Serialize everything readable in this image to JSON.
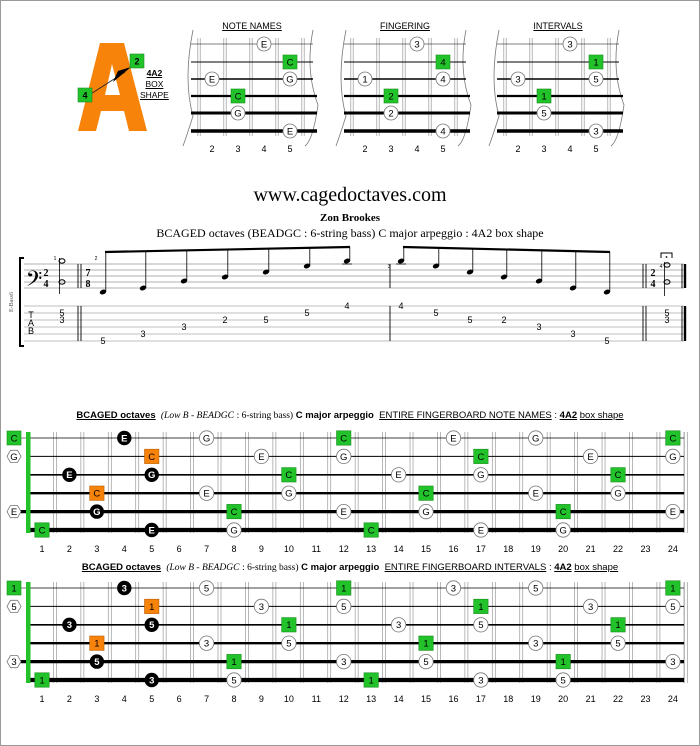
{
  "header": {
    "shape_letter": "A",
    "shape_finger_from": "4",
    "shape_finger_to": "2",
    "shape_label_lines": [
      "4A2",
      "BOX",
      "SHAPE"
    ]
  },
  "mini_diagrams": [
    {
      "title": "NOTE NAMES",
      "fret_labels": [
        "2",
        "3",
        "4",
        "5"
      ],
      "markers": [
        {
          "string": 1,
          "fret": 4,
          "label": "E",
          "kind": "circle"
        },
        {
          "string": 2,
          "fret": 5,
          "label": "C",
          "kind": "root"
        },
        {
          "string": 3,
          "fret": 2,
          "label": "E",
          "kind": "circle"
        },
        {
          "string": 3,
          "fret": 5,
          "label": "G",
          "kind": "circle"
        },
        {
          "string": 4,
          "fret": 3,
          "label": "C",
          "kind": "root"
        },
        {
          "string": 5,
          "fret": 3,
          "label": "G",
          "kind": "circle"
        },
        {
          "string": 6,
          "fret": 5,
          "label": "E",
          "kind": "circle"
        }
      ]
    },
    {
      "title": "FINGERING",
      "fret_labels": [
        "2",
        "3",
        "4",
        "5"
      ],
      "markers": [
        {
          "string": 1,
          "fret": 4,
          "label": "3",
          "kind": "circle"
        },
        {
          "string": 2,
          "fret": 5,
          "label": "4",
          "kind": "root"
        },
        {
          "string": 3,
          "fret": 2,
          "label": "1",
          "kind": "circle"
        },
        {
          "string": 3,
          "fret": 5,
          "label": "4",
          "kind": "circle"
        },
        {
          "string": 4,
          "fret": 3,
          "label": "2",
          "kind": "root"
        },
        {
          "string": 5,
          "fret": 3,
          "label": "2",
          "kind": "circle"
        },
        {
          "string": 6,
          "fret": 5,
          "label": "4",
          "kind": "circle"
        }
      ]
    },
    {
      "title": "INTERVALS",
      "fret_labels": [
        "2",
        "3",
        "4",
        "5"
      ],
      "markers": [
        {
          "string": 1,
          "fret": 4,
          "label": "3",
          "kind": "circle"
        },
        {
          "string": 2,
          "fret": 5,
          "label": "1",
          "kind": "root"
        },
        {
          "string": 3,
          "fret": 2,
          "label": "3",
          "kind": "circle"
        },
        {
          "string": 3,
          "fret": 5,
          "label": "5",
          "kind": "circle"
        },
        {
          "string": 4,
          "fret": 3,
          "label": "1",
          "kind": "root"
        },
        {
          "string": 5,
          "fret": 3,
          "label": "5",
          "kind": "circle"
        },
        {
          "string": 6,
          "fret": 5,
          "label": "3",
          "kind": "circle"
        }
      ]
    }
  ],
  "site": "www.cagedoctaves.com",
  "author": "Zon Brookes",
  "subtitle": "BCAGED octaves (BEADGC : 6-string bass) C major arpeggio : 4A2 box shape",
  "notation": {
    "instrument_label": "E-Bass6",
    "clef": "bass",
    "measures": [
      {
        "number": "1",
        "time_signature": "2/4",
        "tab": [
          {
            "string": 2,
            "fret": "5"
          },
          {
            "string": 3,
            "fret": "3"
          }
        ],
        "chord": true
      },
      {
        "number": "2",
        "time_signature": "7/8",
        "tab": [
          {
            "string": 6,
            "fret": "5"
          },
          {
            "string": 5,
            "fret": "3"
          },
          {
            "string": 4,
            "fret": "3"
          },
          {
            "string": 3,
            "fret": "2"
          },
          {
            "string": 3,
            "fret": "5"
          },
          {
            "string": 2,
            "fret": "5"
          },
          {
            "string": 1,
            "fret": "4"
          }
        ]
      },
      {
        "number": "3",
        "time_signature": "",
        "tab": [
          {
            "string": 1,
            "fret": "4"
          },
          {
            "string": 2,
            "fret": "5"
          },
          {
            "string": 3,
            "fret": "5"
          },
          {
            "string": 3,
            "fret": "2"
          },
          {
            "string": 4,
            "fret": "3"
          },
          {
            "string": 5,
            "fret": "3"
          },
          {
            "string": 6,
            "fret": "5"
          }
        ]
      },
      {
        "number": "4",
        "time_signature": "2/4",
        "tab": [
          {
            "string": 2,
            "fret": "5"
          },
          {
            "string": 3,
            "fret": "3"
          }
        ],
        "chord": true,
        "fermata": true
      }
    ],
    "tab_letters": [
      "T",
      "A",
      "B"
    ]
  },
  "fingerboards": [
    {
      "title_parts": {
        "bold_u": "BCAGED octaves",
        "italic": "(Low B - BEADGC",
        "serif": ": 6-string bass)",
        "bold": "C major arpeggio",
        "u": "ENTIRE FINGERBOARD  NOTE NAMES",
        "colon": ":",
        "bold_u2": "4A2",
        "u2": "box shape"
      },
      "fret_numbers": [
        "1",
        "2",
        "3",
        "4",
        "5",
        "6",
        "7",
        "8",
        "9",
        "10",
        "11",
        "12",
        "13",
        "14",
        "15",
        "16",
        "17",
        "18",
        "19",
        "20",
        "21",
        "22",
        "23",
        "24"
      ],
      "open": [
        {
          "string": 1,
          "label": "C",
          "kind": "root"
        },
        {
          "string": 2,
          "label": "G",
          "kind": "hex"
        },
        {
          "string": 5,
          "label": "E",
          "kind": "hex"
        }
      ],
      "markers": [
        {
          "string": 1,
          "fret": 4,
          "label": "E",
          "kind": "black"
        },
        {
          "string": 1,
          "fret": 7,
          "label": "G",
          "kind": "circle"
        },
        {
          "string": 1,
          "fret": 12,
          "label": "C",
          "kind": "root"
        },
        {
          "string": 1,
          "fret": 16,
          "label": "E",
          "kind": "circle"
        },
        {
          "string": 1,
          "fret": 19,
          "label": "G",
          "kind": "circle"
        },
        {
          "string": 1,
          "fret": 24,
          "label": "C",
          "kind": "root"
        },
        {
          "string": 2,
          "fret": 5,
          "label": "C",
          "kind": "orange"
        },
        {
          "string": 2,
          "fret": 9,
          "label": "E",
          "kind": "circle"
        },
        {
          "string": 2,
          "fret": 12,
          "label": "G",
          "kind": "circle"
        },
        {
          "string": 2,
          "fret": 17,
          "label": "C",
          "kind": "root"
        },
        {
          "string": 2,
          "fret": 21,
          "label": "E",
          "kind": "circle"
        },
        {
          "string": 2,
          "fret": 24,
          "label": "G",
          "kind": "circle"
        },
        {
          "string": 3,
          "fret": 2,
          "label": "E",
          "kind": "black"
        },
        {
          "string": 3,
          "fret": 5,
          "label": "G",
          "kind": "black"
        },
        {
          "string": 3,
          "fret": 10,
          "label": "C",
          "kind": "root"
        },
        {
          "string": 3,
          "fret": 14,
          "label": "E",
          "kind": "circle"
        },
        {
          "string": 3,
          "fret": 17,
          "label": "G",
          "kind": "circle"
        },
        {
          "string": 3,
          "fret": 22,
          "label": "C",
          "kind": "root"
        },
        {
          "string": 4,
          "fret": 3,
          "label": "C",
          "kind": "orange"
        },
        {
          "string": 4,
          "fret": 7,
          "label": "E",
          "kind": "circle"
        },
        {
          "string": 4,
          "fret": 10,
          "label": "G",
          "kind": "circle"
        },
        {
          "string": 4,
          "fret": 15,
          "label": "C",
          "kind": "root"
        },
        {
          "string": 4,
          "fret": 19,
          "label": "E",
          "kind": "circle"
        },
        {
          "string": 4,
          "fret": 22,
          "label": "G",
          "kind": "circle"
        },
        {
          "string": 5,
          "fret": 3,
          "label": "G",
          "kind": "black"
        },
        {
          "string": 5,
          "fret": 8,
          "label": "C",
          "kind": "root"
        },
        {
          "string": 5,
          "fret": 12,
          "label": "E",
          "kind": "circle"
        },
        {
          "string": 5,
          "fret": 15,
          "label": "G",
          "kind": "circle"
        },
        {
          "string": 5,
          "fret": 20,
          "label": "C",
          "kind": "root"
        },
        {
          "string": 5,
          "fret": 24,
          "label": "E",
          "kind": "circle"
        },
        {
          "string": 6,
          "fret": 1,
          "label": "C",
          "kind": "root"
        },
        {
          "string": 6,
          "fret": 5,
          "label": "E",
          "kind": "black"
        },
        {
          "string": 6,
          "fret": 8,
          "label": "G",
          "kind": "circle"
        },
        {
          "string": 6,
          "fret": 13,
          "label": "C",
          "kind": "root"
        },
        {
          "string": 6,
          "fret": 17,
          "label": "E",
          "kind": "circle"
        },
        {
          "string": 6,
          "fret": 20,
          "label": "G",
          "kind": "circle"
        }
      ]
    },
    {
      "title_parts": {
        "bold_u": "BCAGED octaves",
        "italic": "(Low B - BEADGC",
        "serif": ": 6-string bass)",
        "bold": "C major arpeggio",
        "u": "ENTIRE FINGERBOARD   INTERVALS",
        "colon": ":",
        "bold_u2": "4A2",
        "u2": "box shape"
      },
      "fret_numbers": [
        "1",
        "2",
        "3",
        "4",
        "5",
        "6",
        "7",
        "8",
        "9",
        "10",
        "11",
        "12",
        "13",
        "14",
        "15",
        "16",
        "17",
        "18",
        "19",
        "20",
        "21",
        "22",
        "23",
        "24"
      ],
      "open": [
        {
          "string": 1,
          "label": "1",
          "kind": "root"
        },
        {
          "string": 2,
          "label": "5",
          "kind": "hex"
        },
        {
          "string": 5,
          "label": "3",
          "kind": "hex"
        }
      ],
      "markers": [
        {
          "string": 1,
          "fret": 4,
          "label": "3",
          "kind": "black"
        },
        {
          "string": 1,
          "fret": 7,
          "label": "5",
          "kind": "circle"
        },
        {
          "string": 1,
          "fret": 12,
          "label": "1",
          "kind": "root"
        },
        {
          "string": 1,
          "fret": 16,
          "label": "3",
          "kind": "circle"
        },
        {
          "string": 1,
          "fret": 19,
          "label": "5",
          "kind": "circle"
        },
        {
          "string": 1,
          "fret": 24,
          "label": "1",
          "kind": "root"
        },
        {
          "string": 2,
          "fret": 5,
          "label": "1",
          "kind": "orange"
        },
        {
          "string": 2,
          "fret": 9,
          "label": "3",
          "kind": "circle"
        },
        {
          "string": 2,
          "fret": 12,
          "label": "5",
          "kind": "circle"
        },
        {
          "string": 2,
          "fret": 17,
          "label": "1",
          "kind": "root"
        },
        {
          "string": 2,
          "fret": 21,
          "label": "3",
          "kind": "circle"
        },
        {
          "string": 2,
          "fret": 24,
          "label": "5",
          "kind": "circle"
        },
        {
          "string": 3,
          "fret": 2,
          "label": "3",
          "kind": "black"
        },
        {
          "string": 3,
          "fret": 5,
          "label": "5",
          "kind": "black"
        },
        {
          "string": 3,
          "fret": 10,
          "label": "1",
          "kind": "root"
        },
        {
          "string": 3,
          "fret": 14,
          "label": "3",
          "kind": "circle"
        },
        {
          "string": 3,
          "fret": 17,
          "label": "5",
          "kind": "circle"
        },
        {
          "string": 3,
          "fret": 22,
          "label": "1",
          "kind": "root"
        },
        {
          "string": 4,
          "fret": 3,
          "label": "1",
          "kind": "orange"
        },
        {
          "string": 4,
          "fret": 7,
          "label": "3",
          "kind": "circle"
        },
        {
          "string": 4,
          "fret": 10,
          "label": "5",
          "kind": "circle"
        },
        {
          "string": 4,
          "fret": 15,
          "label": "1",
          "kind": "root"
        },
        {
          "string": 4,
          "fret": 19,
          "label": "3",
          "kind": "circle"
        },
        {
          "string": 4,
          "fret": 22,
          "label": "5",
          "kind": "circle"
        },
        {
          "string": 5,
          "fret": 3,
          "label": "5",
          "kind": "black"
        },
        {
          "string": 5,
          "fret": 8,
          "label": "1",
          "kind": "root"
        },
        {
          "string": 5,
          "fret": 12,
          "label": "3",
          "kind": "circle"
        },
        {
          "string": 5,
          "fret": 15,
          "label": "5",
          "kind": "circle"
        },
        {
          "string": 5,
          "fret": 20,
          "label": "1",
          "kind": "root"
        },
        {
          "string": 5,
          "fret": 24,
          "label": "3",
          "kind": "circle"
        },
        {
          "string": 6,
          "fret": 1,
          "label": "1",
          "kind": "root"
        },
        {
          "string": 6,
          "fret": 5,
          "label": "3",
          "kind": "black"
        },
        {
          "string": 6,
          "fret": 8,
          "label": "5",
          "kind": "circle"
        },
        {
          "string": 6,
          "fret": 13,
          "label": "1",
          "kind": "root"
        },
        {
          "string": 6,
          "fret": 17,
          "label": "3",
          "kind": "circle"
        },
        {
          "string": 6,
          "fret": 20,
          "label": "5",
          "kind": "circle"
        }
      ]
    }
  ],
  "colors": {
    "root": "#22c22a",
    "orange": "#f7830b",
    "black": "#000000",
    "shape_letter": "#f7830b"
  }
}
